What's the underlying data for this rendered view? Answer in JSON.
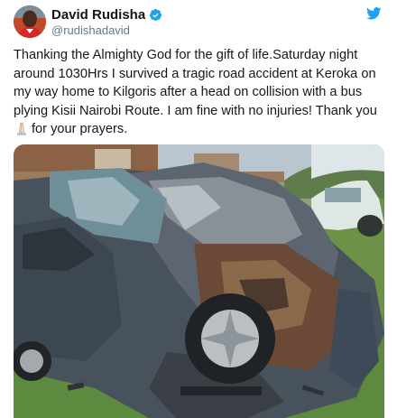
{
  "user": {
    "display_name": "David Rudisha",
    "handle": "@rudishadavid",
    "verified": true,
    "avatar_icon": "profile-photo",
    "verified_icon": "verified-badge-icon",
    "brand_icon": "twitter-bird-icon"
  },
  "tweet": {
    "text_main": "Thanking the Almighty God for the gift of life.Saturday night around 1030Hrs I survived a tragic road accident at Keroka on my way home to Kilgoris after a head on collision with a bus plying Kisii Nairobi Route. I am fine with no injuries! Thank you",
    "emoji_icon": "praying-hands-emoji",
    "text_end": "for your prayers."
  },
  "media": {
    "type": "photo"
  },
  "colors": {
    "text": "#14171a",
    "secondary": "#657786",
    "brand": "#1da1f2",
    "verified": "#1da1f2"
  }
}
